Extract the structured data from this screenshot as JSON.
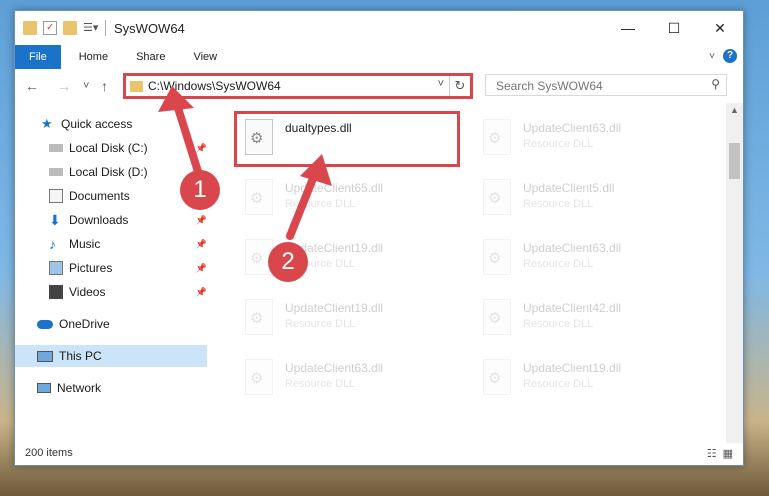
{
  "window": {
    "title": "SysWOW64"
  },
  "ribbon": {
    "tabs": [
      "File",
      "Home",
      "Share",
      "View"
    ]
  },
  "nav": {
    "back": "←",
    "forward": "→",
    "recent": "˅",
    "up": "↑"
  },
  "address": {
    "path": "C:\\Windows\\SysWOW64",
    "dropdown": "˅",
    "refresh": "↻"
  },
  "search": {
    "placeholder": "Search SysWOW64"
  },
  "sidebar": {
    "items": [
      {
        "label": "Quick access"
      },
      {
        "label": "Local Disk (C:)"
      },
      {
        "label": "Local Disk (D:)"
      },
      {
        "label": "Documents"
      },
      {
        "label": "Downloads"
      },
      {
        "label": "Music"
      },
      {
        "label": "Pictures"
      },
      {
        "label": "Videos"
      },
      {
        "label": "OneDrive"
      },
      {
        "label": "This PC"
      },
      {
        "label": "Network"
      }
    ]
  },
  "files": [
    {
      "name": "dualtypes.dll",
      "desc": ""
    },
    {
      "name": "UpdateClient63.dll",
      "desc": "Resource DLL"
    },
    {
      "name": "UpdateClient65.dll",
      "desc": "Resource DLL"
    },
    {
      "name": "UpdateClient5.dll",
      "desc": "Resource DLL"
    },
    {
      "name": "UpdateClient19.dll",
      "desc": "Resource DLL"
    },
    {
      "name": "UpdateClient63.dll",
      "desc": "Resource DLL"
    },
    {
      "name": "UpdateClient19.dll",
      "desc": "Resource DLL"
    },
    {
      "name": "UpdateClient42.dll",
      "desc": "Resource DLL"
    },
    {
      "name": "UpdateClient63.dll",
      "desc": "Resource DLL"
    },
    {
      "name": "UpdateClient19.dll",
      "desc": "Resource DLL"
    }
  ],
  "status": {
    "count": "200 items"
  },
  "steps": [
    "1",
    "2"
  ],
  "colors": {
    "accent": "#1a73c9",
    "highlight": "#d9464b",
    "selected": "#cce4f7"
  }
}
